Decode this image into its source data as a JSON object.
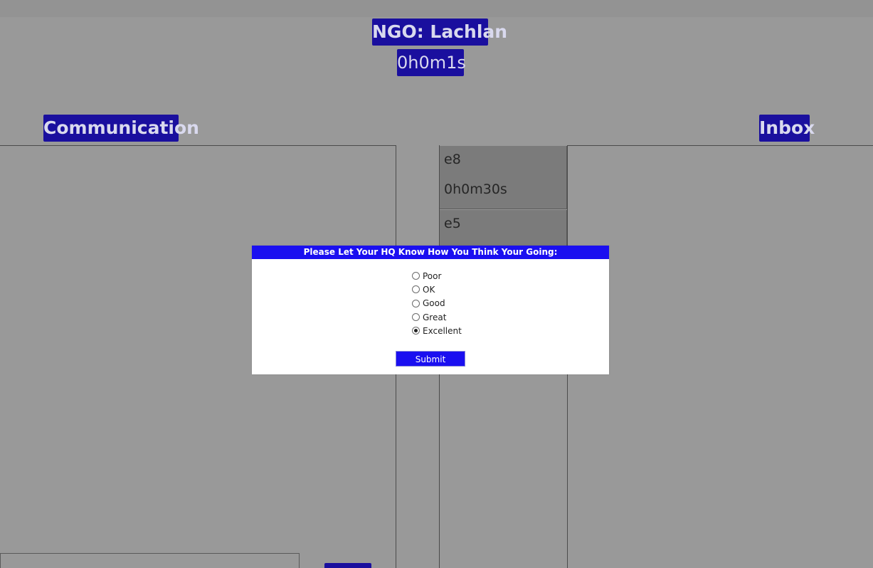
{
  "header": {
    "ngo_title": "NGO: Lachlan",
    "timer": "0h0m1s"
  },
  "panels": {
    "communication_title": "Communication",
    "inbox_title": "Inbox"
  },
  "queue": [
    {
      "id": "e8",
      "time": "0h0m30s"
    },
    {
      "id": "e5"
    }
  ],
  "dialog": {
    "title": "Please Let Your HQ Know How You Think Your Going:",
    "options": [
      "Poor",
      "OK",
      "Good",
      "Great",
      "Excellent"
    ],
    "selected": "Excellent",
    "submit_label": "Submit"
  },
  "colors": {
    "page_background": "#999999",
    "badge": "#1a0f9e",
    "dialog_accent": "#1a0ff0",
    "card": "#7b7b7b"
  }
}
